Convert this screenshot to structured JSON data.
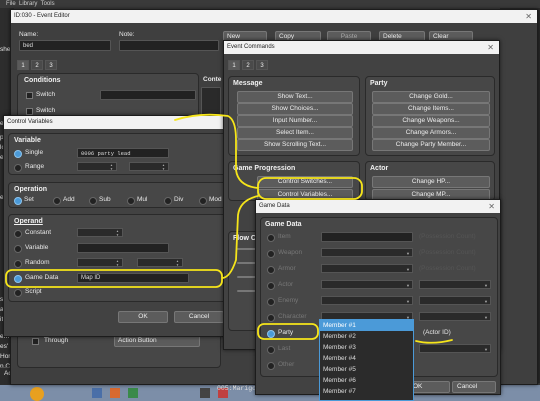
{
  "menubar": {
    "items": [
      "File",
      "Library",
      "Tools",
      "Tools",
      "Help"
    ]
  },
  "left_panel": {
    "items": [
      "shel",
      "er",
      "py",
      "low",
      "ene",
      "ed",
      "s",
      "aud",
      "ita",
      "em",
      "es'",
      "Hor",
      "n Ct"
    ],
    "access_label": "Access"
  },
  "event_editor": {
    "title": "ID:030 - Event Editor",
    "name_label": "Name:",
    "name_value": "bed",
    "note_label": "Note:",
    "page_tabs": [
      "1",
      "2",
      "3"
    ],
    "toolbar": [
      "New",
      "Copy",
      "Paste",
      "Delete",
      "Clear"
    ],
    "conditions_title": "Conditions",
    "conditions_items": [
      "Switch",
      "Switch"
    ],
    "contents_label": "Conte",
    "through_label": "Through",
    "action_button_label": "Action Button",
    "status_text": "005:Marigo"
  },
  "control_variables": {
    "title": "Control Variables",
    "variable_title": "Variable",
    "single_label": "Single",
    "single_value": "0006 party lead",
    "range_label": "Range",
    "operation_title": "Operation",
    "operations": [
      "Set",
      "Add",
      "Sub",
      "Mul",
      "Div",
      "Mod"
    ],
    "operand_title": "Operand",
    "operands": [
      "Constant",
      "Variable",
      "Random",
      "Game Data",
      "Script"
    ],
    "game_data_value": "Map ID",
    "ok": "OK",
    "cancel": "Cancel"
  },
  "event_commands": {
    "title": "Event Commands",
    "tabs": [
      "1",
      "2",
      "3"
    ],
    "message_title": "Message",
    "message_buttons": [
      "Show Text...",
      "Show Choices...",
      "Input Number...",
      "Select Item...",
      "Show Scrolling Text..."
    ],
    "party_title": "Party",
    "party_buttons": [
      "Change Gold...",
      "Change Items...",
      "Change Weapons...",
      "Change Armors...",
      "Change Party Member..."
    ],
    "progression_title": "Game Progression",
    "progression_buttons": [
      "Control Switches...",
      "Control Variables..."
    ],
    "actor_title": "Actor",
    "actor_buttons": [
      "Change HP...",
      "Change MP..."
    ],
    "flow_label": "Flow C"
  },
  "game_data": {
    "title": "Game Data",
    "section_title": "Game Data",
    "options": [
      "Item",
      "Weapon",
      "Armor",
      "Actor",
      "Enemy",
      "Character",
      "Party",
      "Last",
      "Other"
    ],
    "selected": "Party",
    "ghost_labels": [
      "(Possession Count)",
      "(Possession Count)",
      "(Possession Count)"
    ],
    "actor_id_label": "(Actor ID)",
    "dropdown_items": [
      "Member #1",
      "Member #2",
      "Member #3",
      "Member #4",
      "Member #5",
      "Member #6",
      "Member #7"
    ],
    "ok": "OK",
    "cancel": "Cancel"
  },
  "annotation_color": "#f6e51a",
  "selection_color": "#4b9ad8"
}
